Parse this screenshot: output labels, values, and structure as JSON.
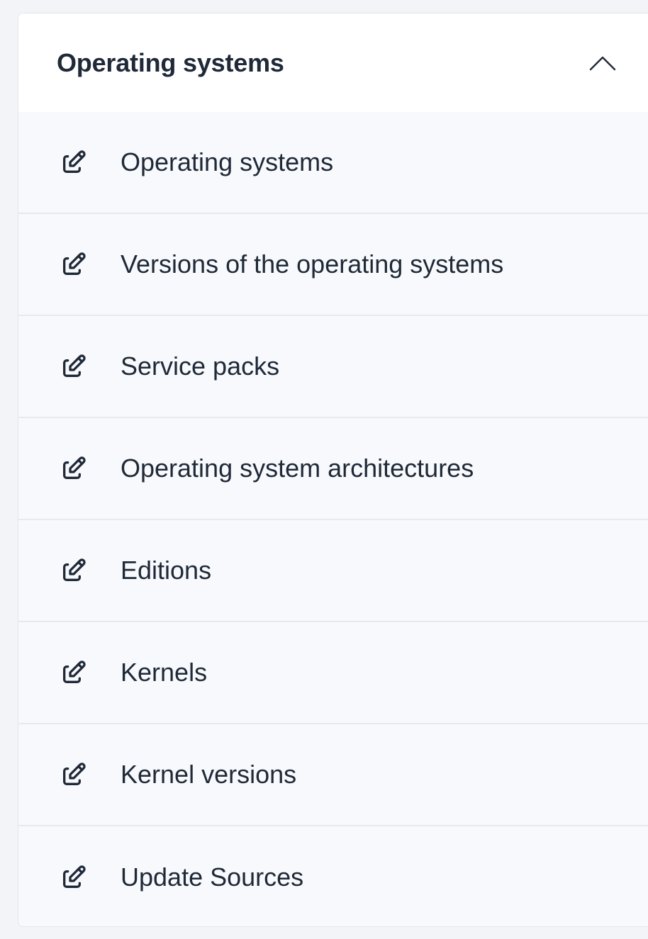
{
  "accordion": {
    "title": "Operating systems",
    "expanded": true,
    "toggle_icon": "chevron-up-icon",
    "item_icon": "edit-icon",
    "colors": {
      "text": "#1f2937",
      "header_bg": "#ffffff",
      "item_bg": "#f7f9fc",
      "divider": "#e6e9ee"
    },
    "items": [
      {
        "label": "Operating systems"
      },
      {
        "label": "Versions of the operating systems"
      },
      {
        "label": "Service packs"
      },
      {
        "label": "Operating system architectures"
      },
      {
        "label": "Editions"
      },
      {
        "label": "Kernels"
      },
      {
        "label": "Kernel versions"
      },
      {
        "label": "Update Sources"
      }
    ]
  }
}
